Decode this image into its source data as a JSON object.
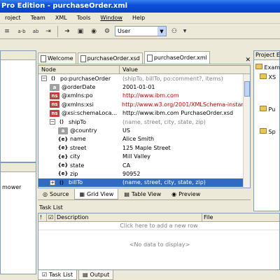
{
  "window": {
    "title": "Pro Edition - purchaseOrder.xml"
  },
  "menu": [
    {
      "label": "roject",
      "key": "project"
    },
    {
      "label": "Team",
      "key": "team"
    },
    {
      "label": "XML",
      "key": "xml"
    },
    {
      "label": "Tools",
      "key": "tools"
    },
    {
      "label": "Window",
      "key": "window",
      "underline": true
    },
    {
      "label": "Help",
      "key": "help"
    }
  ],
  "toolbar": {
    "user_label": "User",
    "ab_label": "a-b",
    "ab2_label": "ab"
  },
  "tabs": [
    {
      "label": "Welcome"
    },
    {
      "label": "purchaseOrder.xsd"
    },
    {
      "label": "purchaseOrder.xml",
      "active": true
    }
  ],
  "grid": {
    "col_node": "Node",
    "col_value": "Value",
    "rows": [
      {
        "exp": "−",
        "icon": "element",
        "node": "po:purchaseOrder",
        "value": "(shipTo, billTo, po:comment?, items)",
        "vstyle": "gray",
        "indent": 0
      },
      {
        "icon": "attribute",
        "node": "@orderDate",
        "value": "2001-01-01",
        "vstyle": "",
        "indent": 1
      },
      {
        "icon": "ns",
        "node": "@xmlns:po",
        "value": "http://www.ibm.com",
        "vstyle": "red",
        "indent": 1
      },
      {
        "icon": "ns",
        "node": "@xmlns:xsi",
        "value": "http://www.w3.org/2001/XMLSchema-instance",
        "vstyle": "red",
        "indent": 1
      },
      {
        "icon": "ns",
        "node": "@xsi:schemaLoca...",
        "value": "http://www.ibm.com PurchaseOrder.xsd",
        "vstyle": "",
        "indent": 1
      },
      {
        "exp": "−",
        "icon": "element",
        "node": "shipTo",
        "value": "(name, street, city, state, zip)",
        "vstyle": "gray",
        "indent": 1
      },
      {
        "icon": "attribute",
        "node": "@country",
        "value": "US",
        "vstyle": "",
        "indent": 2
      },
      {
        "icon": "element-text",
        "node": "name",
        "value": "Alice Smith",
        "vstyle": "",
        "indent": 2
      },
      {
        "icon": "element-text",
        "node": "street",
        "value": "125 Maple Street",
        "vstyle": "",
        "indent": 2
      },
      {
        "icon": "element-text",
        "node": "city",
        "value": "Mill Valley",
        "vstyle": "",
        "indent": 2
      },
      {
        "icon": "element-text",
        "node": "state",
        "value": "CA",
        "vstyle": "",
        "indent": 2
      },
      {
        "icon": "element-text",
        "node": "zip",
        "value": "90952",
        "vstyle": "",
        "indent": 2
      },
      {
        "exp": "+",
        "icon": "element",
        "node": "billTo",
        "value": "(name, street, city, state, zip)",
        "vstyle": "gray",
        "indent": 1,
        "selected": true
      }
    ]
  },
  "views": [
    {
      "label": "Source"
    },
    {
      "label": "Grid View",
      "active": true
    },
    {
      "label": "Table View"
    },
    {
      "label": "Preview"
    }
  ],
  "task": {
    "title": "Task List",
    "col_description": "Description",
    "col_file": "File",
    "add_row": "Click here to add a new row",
    "no_data": "<No data to display>"
  },
  "bottom_tabs": [
    {
      "label": "Task List",
      "active": true
    },
    {
      "label": "Output"
    }
  ],
  "left_panel": {
    "item": "mower"
  },
  "right_panel": {
    "title": "Project Ex",
    "tree": [
      "Exam",
      "XS",
      "Pu",
      "Sp"
    ]
  }
}
